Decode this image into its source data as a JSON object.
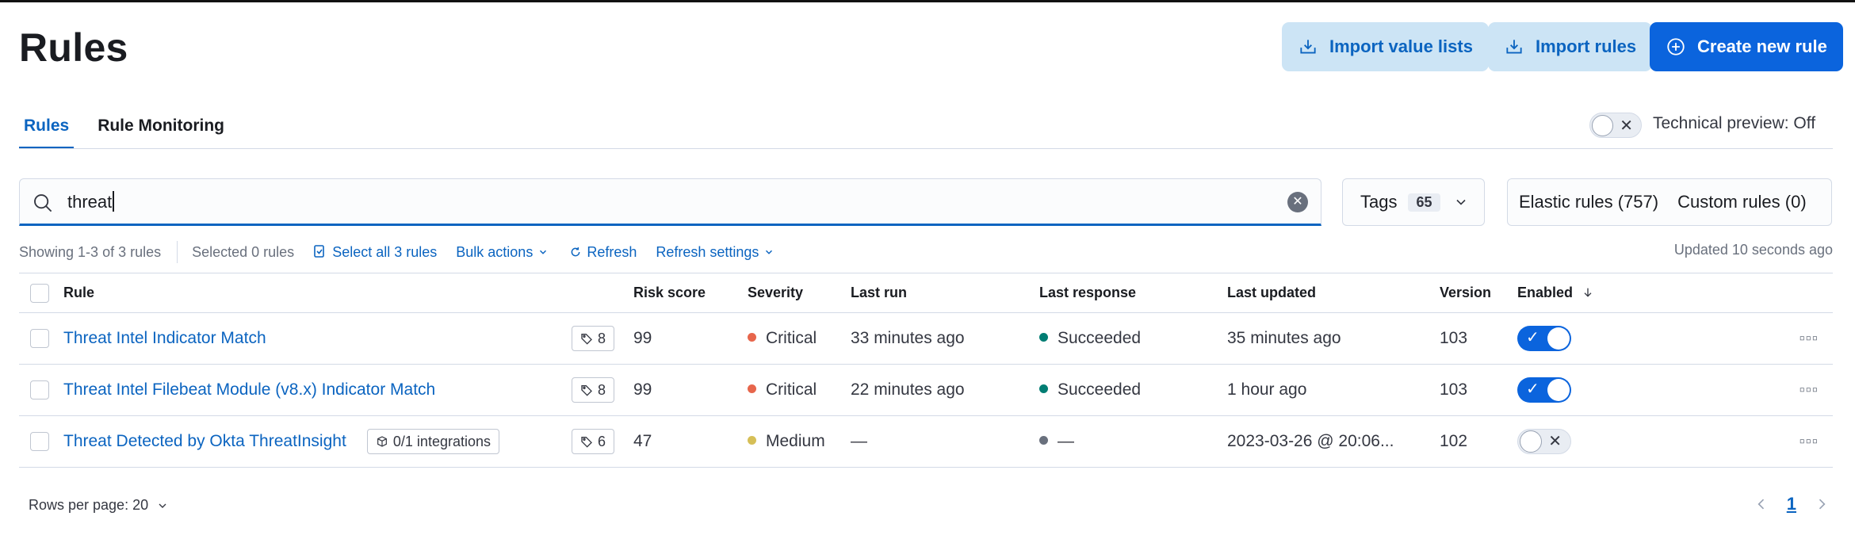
{
  "page": {
    "title": "Rules"
  },
  "header_buttons": {
    "import_value_lists": "Import value lists",
    "import_rules": "Import rules",
    "create_new_rule": "Create new rule"
  },
  "tabs": [
    {
      "label": "Rules",
      "active": true
    },
    {
      "label": "Rule Monitoring",
      "active": false
    }
  ],
  "technical_preview": {
    "label": "Technical preview: Off",
    "enabled": false
  },
  "search": {
    "value": "threat"
  },
  "tags_filter": {
    "label": "Tags",
    "count": "65"
  },
  "rule_filters": {
    "elastic": "Elastic rules (757)",
    "custom": "Custom rules (0)"
  },
  "toolbar": {
    "showing": "Showing 1-3 of 3 rules",
    "selected": "Selected 0 rules",
    "select_all": "Select all 3 rules",
    "bulk_actions": "Bulk actions",
    "refresh": "Refresh",
    "refresh_settings": "Refresh settings",
    "updated": "Updated 10 seconds ago"
  },
  "table": {
    "headers": {
      "rule": "Rule",
      "risk_score": "Risk score",
      "severity": "Severity",
      "last_run": "Last run",
      "last_response": "Last response",
      "last_updated": "Last updated",
      "version": "Version",
      "enabled": "Enabled"
    },
    "rows": [
      {
        "name": "Threat Intel Indicator Match",
        "integrations": "",
        "tags": "8",
        "risk_score": "99",
        "severity": "Critical",
        "severity_color": "#e7664c",
        "last_run": "33 minutes ago",
        "last_response": "Succeeded",
        "response_color": "#017d73",
        "last_updated": "35 minutes ago",
        "version": "103",
        "enabled": true
      },
      {
        "name": "Threat Intel Filebeat Module (v8.x) Indicator Match",
        "integrations": "",
        "tags": "8",
        "risk_score": "99",
        "severity": "Critical",
        "severity_color": "#e7664c",
        "last_run": "22 minutes ago",
        "last_response": "Succeeded",
        "response_color": "#017d73",
        "last_updated": "1 hour ago",
        "version": "103",
        "enabled": true
      },
      {
        "name": "Threat Detected by Okta ThreatInsight",
        "integrations": "0/1 integrations",
        "tags": "6",
        "risk_score": "47",
        "severity": "Medium",
        "severity_color": "#d6bf57",
        "last_run": "—",
        "last_response": "—",
        "response_color": "#69707d",
        "last_updated": "2023-03-26 @ 20:06...",
        "version": "102",
        "enabled": false
      }
    ]
  },
  "pagination": {
    "rows_per_page": "Rows per page: 20",
    "current_page": "1"
  },
  "colors": {
    "accent": "#0b64dd",
    "link": "#0b64c0",
    "light_button": "#cce4f5"
  }
}
